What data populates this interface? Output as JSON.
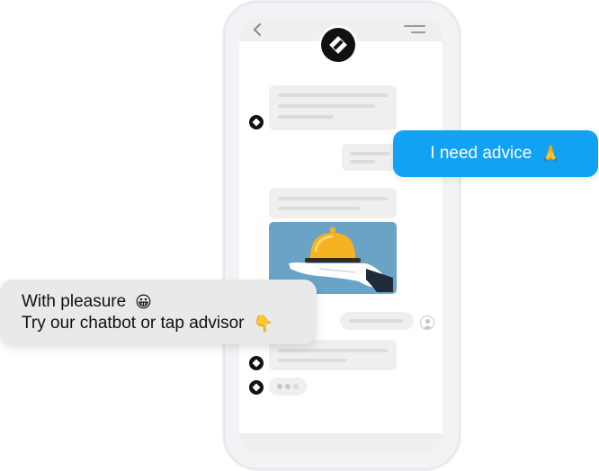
{
  "chat": {
    "user_message": "I need advice",
    "user_message_emoji": "🙏",
    "bot_reply_line1": "With pleasure",
    "bot_reply_line1_emoji": "😀",
    "bot_reply_line2": "Try our chatbot or tap advisor",
    "bot_reply_line2_emoji": "👇"
  },
  "icons": {
    "back": "chevron-left-icon",
    "menu": "menu-icon",
    "brand": "brand-diamond-icon",
    "user": "user-icon",
    "service": "service-bell-icon"
  },
  "colors": {
    "accent_blue": "#12a2f3",
    "bubble_grey": "#e9e9e9",
    "image_bg": "#6aa3c6",
    "bell_gold": "#f5b321"
  }
}
